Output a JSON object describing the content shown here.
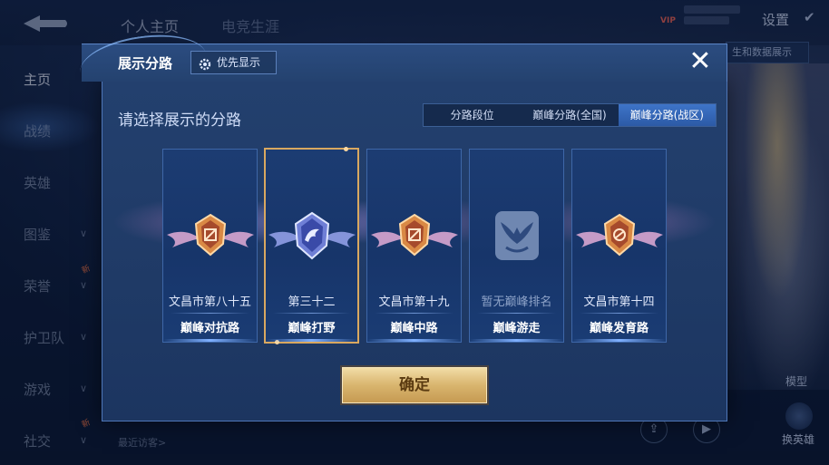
{
  "background": {
    "top_tabs": [
      "个人主页",
      "电竞生涯"
    ],
    "vip_label": "VIP",
    "settings_label": "设置",
    "right_chip": "生和数据展示",
    "sidebar_items": [
      {
        "label": "主页",
        "active": true
      },
      {
        "label": "战绩"
      },
      {
        "label": "英雄"
      },
      {
        "label": "图鉴"
      },
      {
        "label": "荣誉"
      },
      {
        "label": "护卫队"
      },
      {
        "label": "游戏"
      },
      {
        "label": "社交"
      }
    ],
    "new_tag": "新",
    "visitors_label": "最近访客>",
    "model_label": "模型",
    "swap_hero_label": "换英雄"
  },
  "modal": {
    "title": "展示分路",
    "priority_button": "优先显示",
    "close_symbol": "✕",
    "subtitle": "请选择展示的分路",
    "tabs": [
      {
        "label": "分路段位",
        "active": false
      },
      {
        "label": "巅峰分路(全国)",
        "active": false
      },
      {
        "label": "巅峰分路(战区)",
        "active": true
      }
    ],
    "cards": [
      {
        "rank": "文昌市第八十五",
        "lane": "巅峰对抗路",
        "emblem": "orange-crest-icon",
        "selected": false
      },
      {
        "rank": "第三十二",
        "lane": "巅峰打野",
        "emblem": "blue-dragon-crest-icon",
        "selected": true
      },
      {
        "rank": "文昌市第十九",
        "lane": "巅峰中路",
        "emblem": "orange-crest-icon",
        "selected": false
      },
      {
        "rank": "暂无巅峰排名",
        "lane": "巅峰游走",
        "emblem": "wing-shield-icon",
        "selected": false
      },
      {
        "rank": "文昌市第十四",
        "lane": "巅峰发育路",
        "emblem": "orange-crest-icon",
        "selected": false
      }
    ],
    "confirm_button": "确定"
  },
  "colors": {
    "accent_gold": "#d9b56e",
    "selected_border": "#d9a860",
    "active_tab": "#3e74c8",
    "modal_bg": "#23406e"
  }
}
